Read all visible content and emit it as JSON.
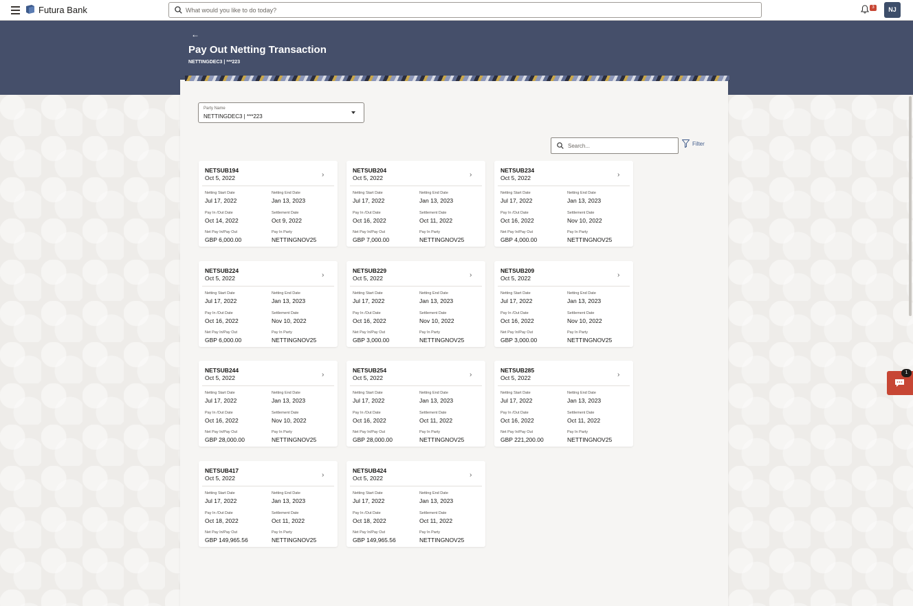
{
  "app": {
    "brand": "Futura Bank"
  },
  "topbar": {
    "search_placeholder": "What would you like to do today?",
    "notification_count": "3",
    "avatar_initials": "NJ"
  },
  "header": {
    "back_symbol": "←",
    "title": "Pay Out Netting Transaction",
    "subtitle": "NETTINGDEC3 | ***223"
  },
  "party_select": {
    "label": "Party Name",
    "value": "NETTINGDEC3 | ***223"
  },
  "list_search": {
    "placeholder": "Search..."
  },
  "filter": {
    "label": "Filter"
  },
  "field_labels": {
    "start": "Netting Start Date",
    "end": "Netting End Date",
    "payout": "Pay In /Out Date",
    "settle": "Settlement Date",
    "net": "Net Pay In/Pay Out",
    "party": "Pay In Party"
  },
  "cards": [
    {
      "id": "NETSUB194",
      "date": "Oct 5, 2022",
      "start": "Jul 17, 2022",
      "end": "Jan 13, 2023",
      "payout": "Oct 14, 2022",
      "settle": "Oct 9, 2022",
      "net": "GBP 6,000.00",
      "party": "NETTINGNOV25"
    },
    {
      "id": "NETSUB204",
      "date": "Oct 5, 2022",
      "start": "Jul 17, 2022",
      "end": "Jan 13, 2023",
      "payout": "Oct 16, 2022",
      "settle": "Oct 11, 2022",
      "net": "GBP 7,000.00",
      "party": "NETTINGNOV25"
    },
    {
      "id": "NETSUB234",
      "date": "Oct 5, 2022",
      "start": "Jul 17, 2022",
      "end": "Jan 13, 2023",
      "payout": "Oct 16, 2022",
      "settle": "Nov 10, 2022",
      "net": "GBP 4,000.00",
      "party": "NETTINGNOV25"
    },
    {
      "id": "NETSUB224",
      "date": "Oct 5, 2022",
      "start": "Jul 17, 2022",
      "end": "Jan 13, 2023",
      "payout": "Oct 16, 2022",
      "settle": "Nov 10, 2022",
      "net": "GBP 6,000.00",
      "party": "NETTINGNOV25"
    },
    {
      "id": "NETSUB229",
      "date": "Oct 5, 2022",
      "start": "Jul 17, 2022",
      "end": "Jan 13, 2023",
      "payout": "Oct 16, 2022",
      "settle": "Nov 10, 2022",
      "net": "GBP 3,000.00",
      "party": "NETTINGNOV25"
    },
    {
      "id": "NETSUB209",
      "date": "Oct 5, 2022",
      "start": "Jul 17, 2022",
      "end": "Jan 13, 2023",
      "payout": "Oct 16, 2022",
      "settle": "Nov 10, 2022",
      "net": "GBP 3,000.00",
      "party": "NETTINGNOV25"
    },
    {
      "id": "NETSUB244",
      "date": "Oct 5, 2022",
      "start": "Jul 17, 2022",
      "end": "Jan 13, 2023",
      "payout": "Oct 16, 2022",
      "settle": "Nov 10, 2022",
      "net": "GBP 28,000.00",
      "party": "NETTINGNOV25"
    },
    {
      "id": "NETSUB254",
      "date": "Oct 5, 2022",
      "start": "Jul 17, 2022",
      "end": "Jan 13, 2023",
      "payout": "Oct 16, 2022",
      "settle": "Oct 11, 2022",
      "net": "GBP 28,000.00",
      "party": "NETTINGNOV25"
    },
    {
      "id": "NETSUB285",
      "date": "Oct 5, 2022",
      "start": "Jul 17, 2022",
      "end": "Jan 13, 2023",
      "payout": "Oct 16, 2022",
      "settle": "Oct 11, 2022",
      "net": "GBP 221,200.00",
      "party": "NETTINGNOV25"
    },
    {
      "id": "NETSUB417",
      "date": "Oct 5, 2022",
      "start": "Jul 17, 2022",
      "end": "Jan 13, 2023",
      "payout": "Oct 18, 2022",
      "settle": "Oct 11, 2022",
      "net": "GBP 149,965.56",
      "party": "NETTINGNOV25"
    },
    {
      "id": "NETSUB424",
      "date": "Oct 5, 2022",
      "start": "Jul 17, 2022",
      "end": "Jan 13, 2023",
      "payout": "Oct 18, 2022",
      "settle": "Oct 11, 2022",
      "net": "GBP 149,965.56",
      "party": "NETTINGNOV25"
    }
  ],
  "chat": {
    "badge": "1"
  },
  "colors": {
    "header_band": "#454f6a",
    "accent_red": "#c74634",
    "avatar": "#3d4e6a"
  }
}
